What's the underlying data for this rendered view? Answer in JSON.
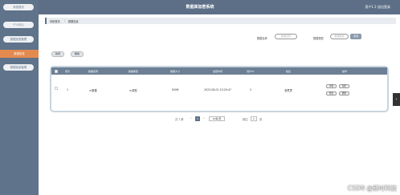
{
  "header": {
    "title": "数据库加密系统",
    "user": "用户1 2   退出登录"
  },
  "sidebar": {
    "items": [
      "系统首页",
      "个人中心",
      "数据加密管理",
      "数据信息",
      "数据信息管理"
    ]
  },
  "breadcrumb": {
    "home": "系统首页",
    "sep": "/",
    "current": "数据信息"
  },
  "search": {
    "name_label": "数据名称",
    "name_placeholder": "数据名称",
    "type_label": "数据类型",
    "type_placeholder": "数据类型",
    "button": "查询"
  },
  "actions": {
    "add": "新增",
    "delete": "删除"
  },
  "table": {
    "headers": [
      "索引",
      "数据名称",
      "数据类型",
      "数据大小",
      "加密时间",
      "用户ID",
      "姓名",
      "操作"
    ],
    "rows": [
      {
        "index": "1",
        "name": "m数据",
        "type": "m类型",
        "size": "500M",
        "time": "2023-08-01 10:20:47",
        "uid": "2",
        "uname": "张思思",
        "ops": [
          "详情",
          "加密",
          "修改",
          "删除"
        ]
      }
    ]
  },
  "pagination": {
    "total": "共 1 条",
    "prev": "<",
    "page": "1",
    "next": ">",
    "page_size": "10条/页",
    "goto_label": "前往",
    "goto_value": "1",
    "goto_suffix": "页"
  },
  "watermark": "CSDN @新时科技"
}
